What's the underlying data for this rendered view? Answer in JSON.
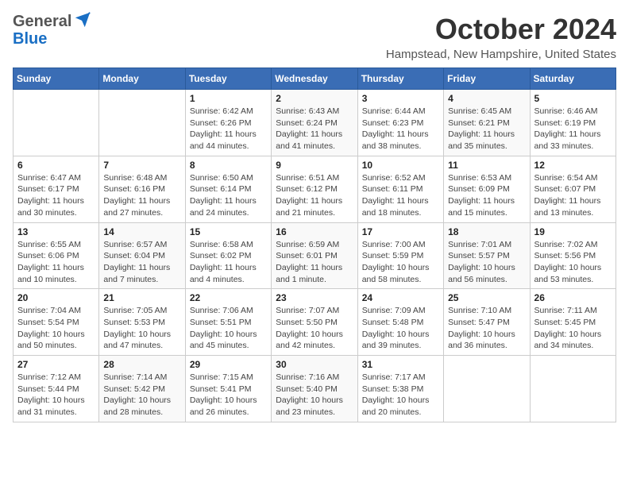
{
  "header": {
    "logo_general": "General",
    "logo_blue": "Blue",
    "month_title": "October 2024",
    "location": "Hampstead, New Hampshire, United States"
  },
  "days_of_week": [
    "Sunday",
    "Monday",
    "Tuesday",
    "Wednesday",
    "Thursday",
    "Friday",
    "Saturday"
  ],
  "weeks": [
    [
      {
        "day": "",
        "detail": ""
      },
      {
        "day": "",
        "detail": ""
      },
      {
        "day": "1",
        "detail": "Sunrise: 6:42 AM\nSunset: 6:26 PM\nDaylight: 11 hours and 44 minutes."
      },
      {
        "day": "2",
        "detail": "Sunrise: 6:43 AM\nSunset: 6:24 PM\nDaylight: 11 hours and 41 minutes."
      },
      {
        "day": "3",
        "detail": "Sunrise: 6:44 AM\nSunset: 6:23 PM\nDaylight: 11 hours and 38 minutes."
      },
      {
        "day": "4",
        "detail": "Sunrise: 6:45 AM\nSunset: 6:21 PM\nDaylight: 11 hours and 35 minutes."
      },
      {
        "day": "5",
        "detail": "Sunrise: 6:46 AM\nSunset: 6:19 PM\nDaylight: 11 hours and 33 minutes."
      }
    ],
    [
      {
        "day": "6",
        "detail": "Sunrise: 6:47 AM\nSunset: 6:17 PM\nDaylight: 11 hours and 30 minutes."
      },
      {
        "day": "7",
        "detail": "Sunrise: 6:48 AM\nSunset: 6:16 PM\nDaylight: 11 hours and 27 minutes."
      },
      {
        "day": "8",
        "detail": "Sunrise: 6:50 AM\nSunset: 6:14 PM\nDaylight: 11 hours and 24 minutes."
      },
      {
        "day": "9",
        "detail": "Sunrise: 6:51 AM\nSunset: 6:12 PM\nDaylight: 11 hours and 21 minutes."
      },
      {
        "day": "10",
        "detail": "Sunrise: 6:52 AM\nSunset: 6:11 PM\nDaylight: 11 hours and 18 minutes."
      },
      {
        "day": "11",
        "detail": "Sunrise: 6:53 AM\nSunset: 6:09 PM\nDaylight: 11 hours and 15 minutes."
      },
      {
        "day": "12",
        "detail": "Sunrise: 6:54 AM\nSunset: 6:07 PM\nDaylight: 11 hours and 13 minutes."
      }
    ],
    [
      {
        "day": "13",
        "detail": "Sunrise: 6:55 AM\nSunset: 6:06 PM\nDaylight: 11 hours and 10 minutes."
      },
      {
        "day": "14",
        "detail": "Sunrise: 6:57 AM\nSunset: 6:04 PM\nDaylight: 11 hours and 7 minutes."
      },
      {
        "day": "15",
        "detail": "Sunrise: 6:58 AM\nSunset: 6:02 PM\nDaylight: 11 hours and 4 minutes."
      },
      {
        "day": "16",
        "detail": "Sunrise: 6:59 AM\nSunset: 6:01 PM\nDaylight: 11 hours and 1 minute."
      },
      {
        "day": "17",
        "detail": "Sunrise: 7:00 AM\nSunset: 5:59 PM\nDaylight: 10 hours and 58 minutes."
      },
      {
        "day": "18",
        "detail": "Sunrise: 7:01 AM\nSunset: 5:57 PM\nDaylight: 10 hours and 56 minutes."
      },
      {
        "day": "19",
        "detail": "Sunrise: 7:02 AM\nSunset: 5:56 PM\nDaylight: 10 hours and 53 minutes."
      }
    ],
    [
      {
        "day": "20",
        "detail": "Sunrise: 7:04 AM\nSunset: 5:54 PM\nDaylight: 10 hours and 50 minutes."
      },
      {
        "day": "21",
        "detail": "Sunrise: 7:05 AM\nSunset: 5:53 PM\nDaylight: 10 hours and 47 minutes."
      },
      {
        "day": "22",
        "detail": "Sunrise: 7:06 AM\nSunset: 5:51 PM\nDaylight: 10 hours and 45 minutes."
      },
      {
        "day": "23",
        "detail": "Sunrise: 7:07 AM\nSunset: 5:50 PM\nDaylight: 10 hours and 42 minutes."
      },
      {
        "day": "24",
        "detail": "Sunrise: 7:09 AM\nSunset: 5:48 PM\nDaylight: 10 hours and 39 minutes."
      },
      {
        "day": "25",
        "detail": "Sunrise: 7:10 AM\nSunset: 5:47 PM\nDaylight: 10 hours and 36 minutes."
      },
      {
        "day": "26",
        "detail": "Sunrise: 7:11 AM\nSunset: 5:45 PM\nDaylight: 10 hours and 34 minutes."
      }
    ],
    [
      {
        "day": "27",
        "detail": "Sunrise: 7:12 AM\nSunset: 5:44 PM\nDaylight: 10 hours and 31 minutes."
      },
      {
        "day": "28",
        "detail": "Sunrise: 7:14 AM\nSunset: 5:42 PM\nDaylight: 10 hours and 28 minutes."
      },
      {
        "day": "29",
        "detail": "Sunrise: 7:15 AM\nSunset: 5:41 PM\nDaylight: 10 hours and 26 minutes."
      },
      {
        "day": "30",
        "detail": "Sunrise: 7:16 AM\nSunset: 5:40 PM\nDaylight: 10 hours and 23 minutes."
      },
      {
        "day": "31",
        "detail": "Sunrise: 7:17 AM\nSunset: 5:38 PM\nDaylight: 10 hours and 20 minutes."
      },
      {
        "day": "",
        "detail": ""
      },
      {
        "day": "",
        "detail": ""
      }
    ]
  ]
}
